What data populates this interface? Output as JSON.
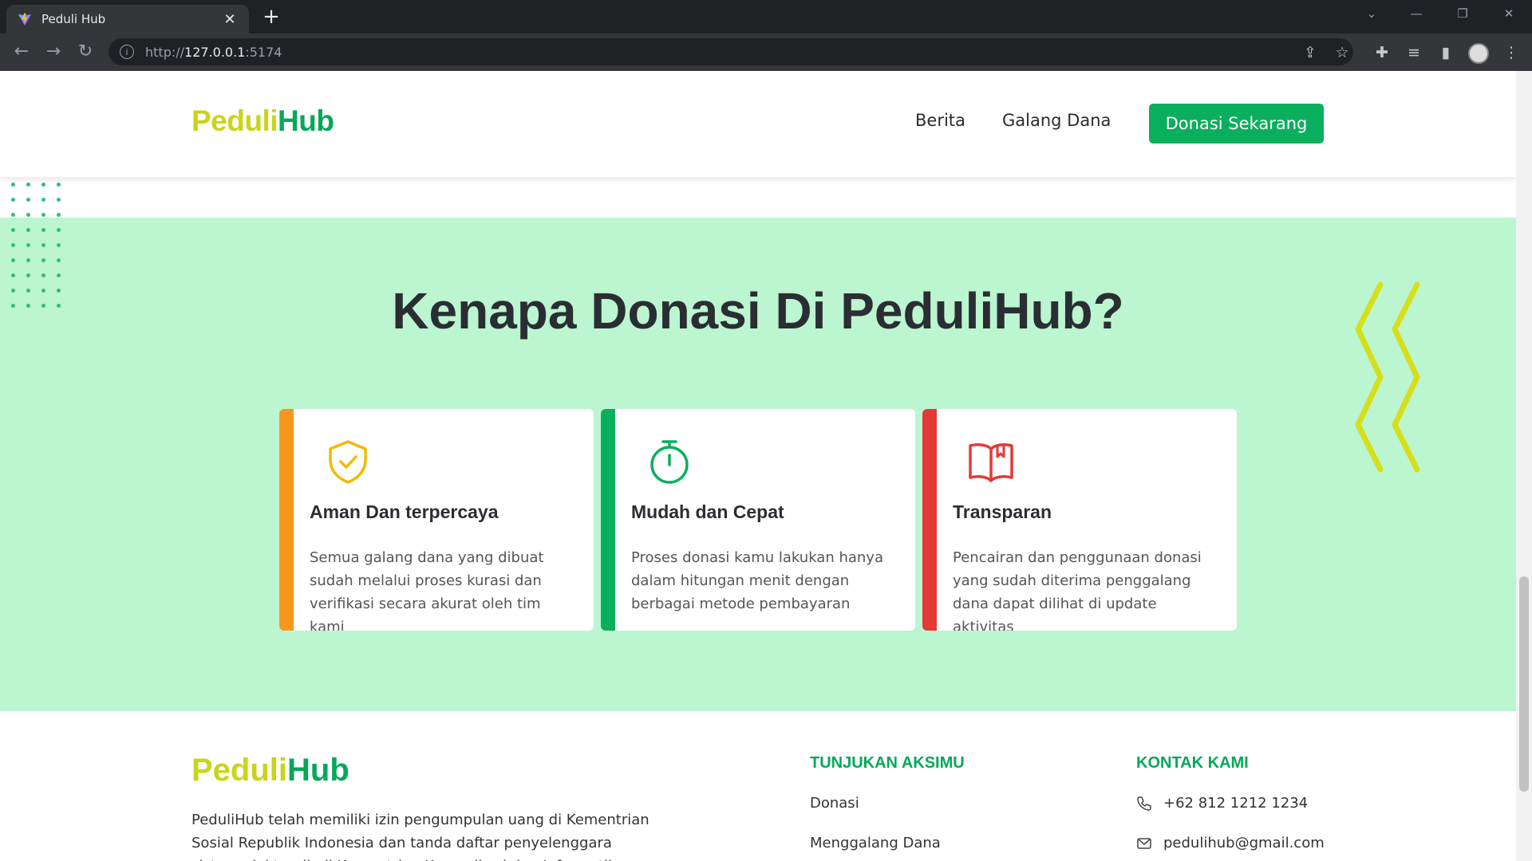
{
  "browser": {
    "tab_title": "Peduli Hub",
    "url_prefix": "http://",
    "url_host": "127.0.0.1",
    "url_port": ":5174"
  },
  "header": {
    "logo_part1": "Peduli",
    "logo_part2": "Hub",
    "nav": [
      "Berita",
      "Galang Dana"
    ],
    "cta_label": "Donasi Sekarang"
  },
  "why": {
    "title": "Kenapa Donasi Di PeduliHub?",
    "cards": [
      {
        "title": "Aman Dan terpercaya",
        "text": "Semua galang dana yang dibuat sudah melalui proses kurasi dan verifikasi secara akurat oleh tim kami",
        "accent": "#f7971e",
        "icon": "shield-check-icon"
      },
      {
        "title": "Mudah dan Cepat",
        "text": "Proses donasi kamu lakukan hanya dalam hitungan menit dengan berbagai metode pembayaran",
        "accent": "#0aaf5e",
        "icon": "stopwatch-icon"
      },
      {
        "title": "Transparan",
        "text": "Pencairan dan penggunaan donasi yang sudah diterima penggalang dana dapat dilihat di update aktivitas",
        "accent": "#e53935",
        "icon": "open-book-icon"
      }
    ]
  },
  "footer": {
    "logo_part1": "Peduli",
    "logo_part2": "Hub",
    "description": "PeduliHub telah memiliki izin pengumpulan uang di Kementrian Sosial Republik Indonesia dan tanda daftar penyelenggara sistem elektronik di Kementrian Komunikasi dan Informatika",
    "aksi_heading": "TUNJUKAN AKSIMU",
    "aksi_links": [
      "Donasi",
      "Menggalang Dana"
    ],
    "kontak_heading": "KONTAK KAMI",
    "phone": "+62 812 1212 1234",
    "email": "pedulihub@gmail.com"
  },
  "colors": {
    "brand_green": "#0aaf5e",
    "brand_lime": "#c9d41a",
    "section_bg": "#bbf6d0"
  }
}
